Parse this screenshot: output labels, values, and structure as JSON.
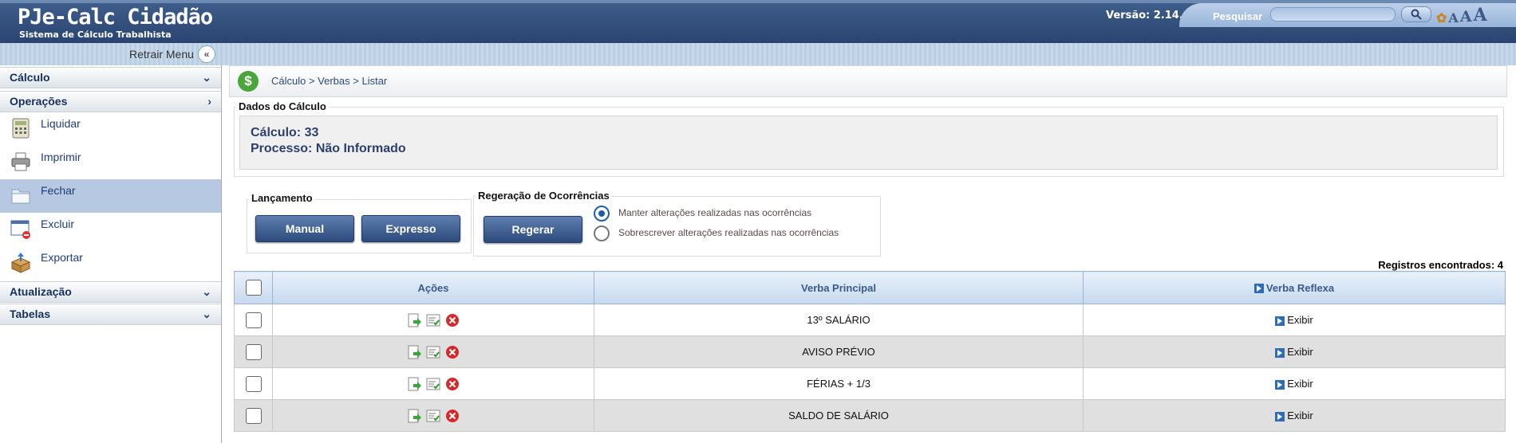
{
  "header": {
    "title": "PJe-Calc Cidadão",
    "subtitle": "Sistema de Cálculo Trabalhista",
    "version": "Versão: 2.14.0",
    "search_label": "Pesquisar",
    "search_value": ""
  },
  "subbar": {
    "retrair": "Retrair Menu"
  },
  "sidebar": {
    "calculo": "Cálculo",
    "operacoes": "Operações",
    "items": [
      {
        "label": "Liquidar",
        "icon": "calculator-icon"
      },
      {
        "label": "Imprimir",
        "icon": "printer-icon"
      },
      {
        "label": "Fechar",
        "icon": "folder-icon"
      },
      {
        "label": "Excluir",
        "icon": "delete-window-icon"
      },
      {
        "label": "Exportar",
        "icon": "export-box-icon"
      }
    ],
    "atualizacao": "Atualização",
    "tabelas": "Tabelas"
  },
  "breadcrumb": "Cálculo > Verbas > Listar",
  "dados": {
    "legend": "Dados do Cálculo",
    "calculo": "Cálculo: 33",
    "processo": "Processo: Não Informado"
  },
  "lancamento": {
    "legend": "Lançamento",
    "manual": "Manual",
    "expresso": "Expresso"
  },
  "regeracao": {
    "legend": "Regeração de Ocorrências",
    "regerar": "Regerar",
    "opt1": "Manter alterações realizadas nas ocorrências",
    "opt2": "Sobrescrever alterações realizadas nas ocorrências",
    "selected": "opt1"
  },
  "registros": "Registros encontrados: 4",
  "table": {
    "headers": {
      "acoes": "Ações",
      "verba_principal": "Verba Principal",
      "verba_reflexa": "Verba Reflexa"
    },
    "exibir": "Exibir",
    "rows": [
      {
        "verba": "13º SALÁRIO"
      },
      {
        "verba": "AVISO PRÉVIO"
      },
      {
        "verba": "FÉRIAS + 1/3"
      },
      {
        "verba": "SALDO DE SALÁRIO"
      }
    ]
  },
  "colors": {
    "header": "#2a4470",
    "accent": "#1e3c78",
    "active_item": "#b7c9e2"
  }
}
